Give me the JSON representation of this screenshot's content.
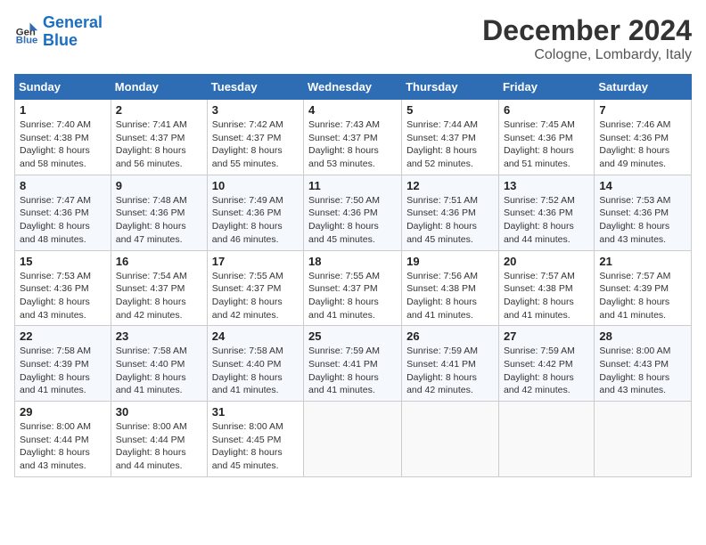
{
  "logo": {
    "line1": "General",
    "line2": "Blue"
  },
  "title": "December 2024",
  "location": "Cologne, Lombardy, Italy",
  "weekdays": [
    "Sunday",
    "Monday",
    "Tuesday",
    "Wednesday",
    "Thursday",
    "Friday",
    "Saturday"
  ],
  "weeks": [
    [
      {
        "day": "1",
        "sunrise": "7:40 AM",
        "sunset": "4:38 PM",
        "daylight": "8 hours and 58 minutes."
      },
      {
        "day": "2",
        "sunrise": "7:41 AM",
        "sunset": "4:37 PM",
        "daylight": "8 hours and 56 minutes."
      },
      {
        "day": "3",
        "sunrise": "7:42 AM",
        "sunset": "4:37 PM",
        "daylight": "8 hours and 55 minutes."
      },
      {
        "day": "4",
        "sunrise": "7:43 AM",
        "sunset": "4:37 PM",
        "daylight": "8 hours and 53 minutes."
      },
      {
        "day": "5",
        "sunrise": "7:44 AM",
        "sunset": "4:37 PM",
        "daylight": "8 hours and 52 minutes."
      },
      {
        "day": "6",
        "sunrise": "7:45 AM",
        "sunset": "4:36 PM",
        "daylight": "8 hours and 51 minutes."
      },
      {
        "day": "7",
        "sunrise": "7:46 AM",
        "sunset": "4:36 PM",
        "daylight": "8 hours and 49 minutes."
      }
    ],
    [
      {
        "day": "8",
        "sunrise": "7:47 AM",
        "sunset": "4:36 PM",
        "daylight": "8 hours and 48 minutes."
      },
      {
        "day": "9",
        "sunrise": "7:48 AM",
        "sunset": "4:36 PM",
        "daylight": "8 hours and 47 minutes."
      },
      {
        "day": "10",
        "sunrise": "7:49 AM",
        "sunset": "4:36 PM",
        "daylight": "8 hours and 46 minutes."
      },
      {
        "day": "11",
        "sunrise": "7:50 AM",
        "sunset": "4:36 PM",
        "daylight": "8 hours and 45 minutes."
      },
      {
        "day": "12",
        "sunrise": "7:51 AM",
        "sunset": "4:36 PM",
        "daylight": "8 hours and 45 minutes."
      },
      {
        "day": "13",
        "sunrise": "7:52 AM",
        "sunset": "4:36 PM",
        "daylight": "8 hours and 44 minutes."
      },
      {
        "day": "14",
        "sunrise": "7:53 AM",
        "sunset": "4:36 PM",
        "daylight": "8 hours and 43 minutes."
      }
    ],
    [
      {
        "day": "15",
        "sunrise": "7:53 AM",
        "sunset": "4:36 PM",
        "daylight": "8 hours and 43 minutes."
      },
      {
        "day": "16",
        "sunrise": "7:54 AM",
        "sunset": "4:37 PM",
        "daylight": "8 hours and 42 minutes."
      },
      {
        "day": "17",
        "sunrise": "7:55 AM",
        "sunset": "4:37 PM",
        "daylight": "8 hours and 42 minutes."
      },
      {
        "day": "18",
        "sunrise": "7:55 AM",
        "sunset": "4:37 PM",
        "daylight": "8 hours and 41 minutes."
      },
      {
        "day": "19",
        "sunrise": "7:56 AM",
        "sunset": "4:38 PM",
        "daylight": "8 hours and 41 minutes."
      },
      {
        "day": "20",
        "sunrise": "7:57 AM",
        "sunset": "4:38 PM",
        "daylight": "8 hours and 41 minutes."
      },
      {
        "day": "21",
        "sunrise": "7:57 AM",
        "sunset": "4:39 PM",
        "daylight": "8 hours and 41 minutes."
      }
    ],
    [
      {
        "day": "22",
        "sunrise": "7:58 AM",
        "sunset": "4:39 PM",
        "daylight": "8 hours and 41 minutes."
      },
      {
        "day": "23",
        "sunrise": "7:58 AM",
        "sunset": "4:40 PM",
        "daylight": "8 hours and 41 minutes."
      },
      {
        "day": "24",
        "sunrise": "7:58 AM",
        "sunset": "4:40 PM",
        "daylight": "8 hours and 41 minutes."
      },
      {
        "day": "25",
        "sunrise": "7:59 AM",
        "sunset": "4:41 PM",
        "daylight": "8 hours and 41 minutes."
      },
      {
        "day": "26",
        "sunrise": "7:59 AM",
        "sunset": "4:41 PM",
        "daylight": "8 hours and 42 minutes."
      },
      {
        "day": "27",
        "sunrise": "7:59 AM",
        "sunset": "4:42 PM",
        "daylight": "8 hours and 42 minutes."
      },
      {
        "day": "28",
        "sunrise": "8:00 AM",
        "sunset": "4:43 PM",
        "daylight": "8 hours and 43 minutes."
      }
    ],
    [
      {
        "day": "29",
        "sunrise": "8:00 AM",
        "sunset": "4:44 PM",
        "daylight": "8 hours and 43 minutes."
      },
      {
        "day": "30",
        "sunrise": "8:00 AM",
        "sunset": "4:44 PM",
        "daylight": "8 hours and 44 minutes."
      },
      {
        "day": "31",
        "sunrise": "8:00 AM",
        "sunset": "4:45 PM",
        "daylight": "8 hours and 45 minutes."
      },
      null,
      null,
      null,
      null
    ]
  ]
}
